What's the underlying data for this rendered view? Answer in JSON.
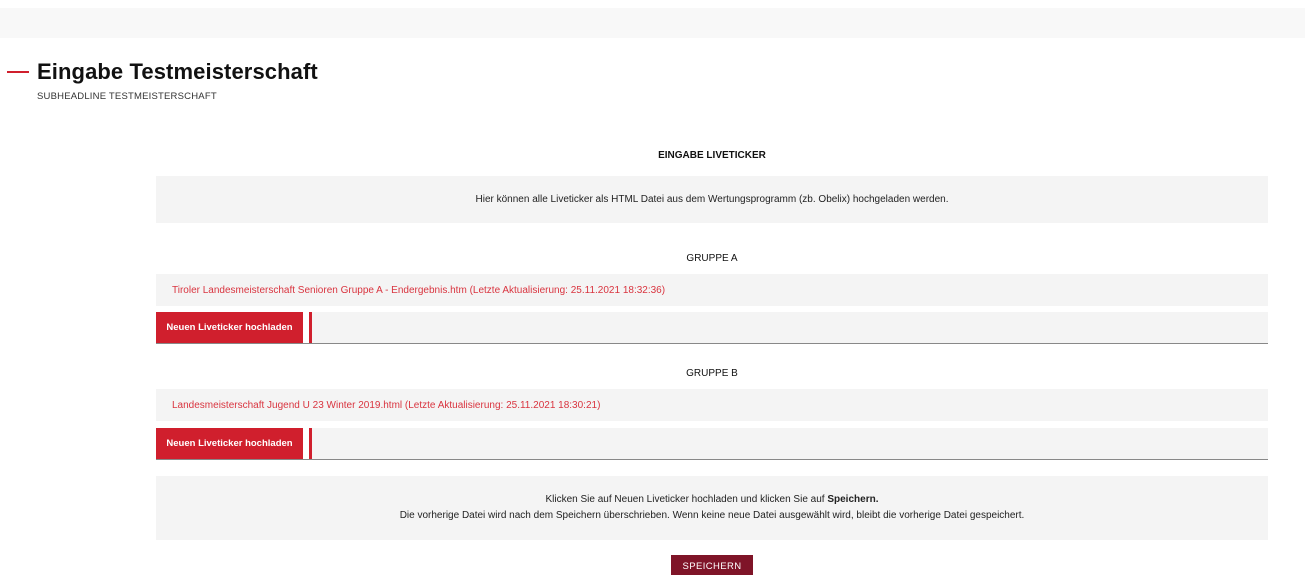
{
  "colors": {
    "accent": "#d01f2d",
    "link": "#d9343f",
    "save": "#7f1428"
  },
  "header": {
    "title": "Eingabe Testmeisterschaft",
    "subheadline": "SUBHEADLINE TESTMEISTERSCHAFT"
  },
  "liveticker": {
    "section_title": "EINGABE LIVETICKER",
    "info_text": "Hier können alle Liveticker als HTML Datei aus dem Wertungsprogramm (zb. Obelix) hochgeladen werden.",
    "groups": [
      {
        "title": "GRUPPE A",
        "file_link": "Tiroler Landesmeisterschaft Senioren Gruppe A - Endergebnis.htm (Letzte Aktualisierung: 25.11.2021 18:32:36)",
        "upload_label": "Neuen Liveticker hochladen"
      },
      {
        "title": "GRUPPE B",
        "file_link": "Landesmeisterschaft Jugend U 23 Winter 2019.html (Letzte Aktualisierung: 25.11.2021 18:30:21)",
        "upload_label": "Neuen Liveticker hochladen"
      }
    ]
  },
  "instructions": {
    "line1_prefix": "Klicken Sie auf Neuen Liveticker hochladen und klicken Sie auf ",
    "line1_bold": "Speichern.",
    "line2": "Die vorherige Datei wird nach dem Speichern überschrieben. Wenn keine neue Datei ausgewählt wird, bleibt die vorherige Datei gespeichert."
  },
  "save_label": "SPEICHERN"
}
